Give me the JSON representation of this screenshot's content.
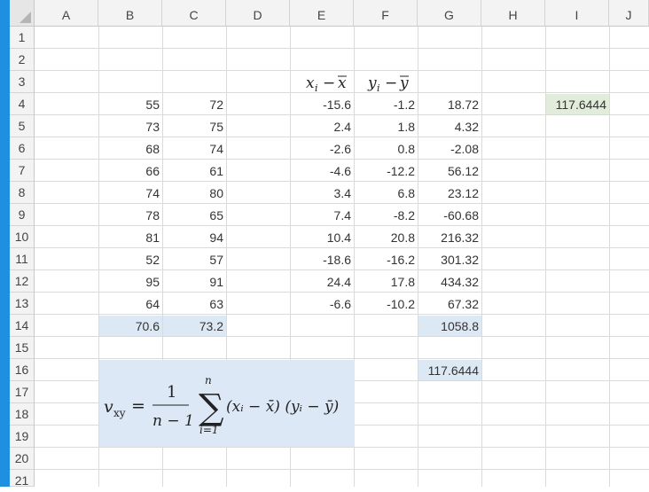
{
  "columns": [
    "A",
    "B",
    "C",
    "D",
    "E",
    "F",
    "G",
    "H",
    "I",
    "J"
  ],
  "rows": [
    "1",
    "2",
    "3",
    "4",
    "5",
    "6",
    "7",
    "8",
    "9",
    "10",
    "11",
    "12",
    "13",
    "14",
    "15",
    "16",
    "17",
    "18",
    "19",
    "20",
    "21"
  ],
  "headers": {
    "E3": "x_i − x̄",
    "F3": "y_i − ȳ"
  },
  "data_rows": [
    {
      "row": "4",
      "B": "55",
      "C": "72",
      "E": "-15.6",
      "F": "-1.2",
      "G": "18.72"
    },
    {
      "row": "5",
      "B": "73",
      "C": "75",
      "E": "2.4",
      "F": "1.8",
      "G": "4.32"
    },
    {
      "row": "6",
      "B": "68",
      "C": "74",
      "E": "-2.6",
      "F": "0.8",
      "G": "-2.08"
    },
    {
      "row": "7",
      "B": "66",
      "C": "61",
      "E": "-4.6",
      "F": "-12.2",
      "G": "56.12"
    },
    {
      "row": "8",
      "B": "74",
      "C": "80",
      "E": "3.4",
      "F": "6.8",
      "G": "23.12"
    },
    {
      "row": "9",
      "B": "78",
      "C": "65",
      "E": "7.4",
      "F": "-8.2",
      "G": "-60.68"
    },
    {
      "row": "10",
      "B": "81",
      "C": "94",
      "E": "10.4",
      "F": "20.8",
      "G": "216.32"
    },
    {
      "row": "11",
      "B": "52",
      "C": "57",
      "E": "-18.6",
      "F": "-16.2",
      "G": "301.32"
    },
    {
      "row": "12",
      "B": "95",
      "C": "91",
      "E": "24.4",
      "F": "17.8",
      "G": "434.32"
    },
    {
      "row": "13",
      "B": "64",
      "C": "63",
      "E": "-6.6",
      "F": "-10.2",
      "G": "67.32"
    }
  ],
  "means": {
    "B14": "70.6",
    "C14": "73.2"
  },
  "sum_G14": "1058.8",
  "cov_G16": "117.6444",
  "cov_I4": "117.6444",
  "formula": {
    "lhs": "v",
    "lhs_sub": "xy",
    "frac_num": "1",
    "frac_den": "n − 1",
    "sigma": "∑",
    "sigma_top": "n",
    "sigma_bottom": "i=1",
    "term": "(xᵢ − x̄) (yᵢ − ȳ)"
  },
  "colors": {
    "highlight_blue": "#dde8f5",
    "highlight_green": "#e1ecda",
    "window_accent": "#1f8fe0"
  }
}
